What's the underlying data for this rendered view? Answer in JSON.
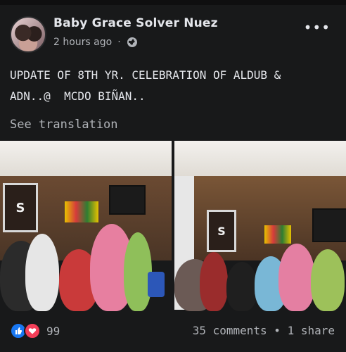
{
  "post": {
    "author": "Baby Grace Solver Nuez",
    "time": "2 hours ago",
    "dot": "·",
    "more_label": "•••",
    "text": "UPDATE OF 8TH YR. CELEBRATION OF ALDUB &\nADN..@  MCDO BIÑAN..",
    "translate_label": "See translation"
  },
  "footer": {
    "reaction_count": "99",
    "comments_shares": "35 comments • 1 share"
  },
  "icons": {
    "privacy": "globe-icon",
    "more": "more-options-icon",
    "reactions": [
      "like-icon",
      "love-icon"
    ]
  },
  "colors": {
    "background": "#18191a",
    "text": "#e4e6eb",
    "secondary": "#b0b3b8",
    "like": "#1877f2",
    "love": "#f33e58"
  }
}
